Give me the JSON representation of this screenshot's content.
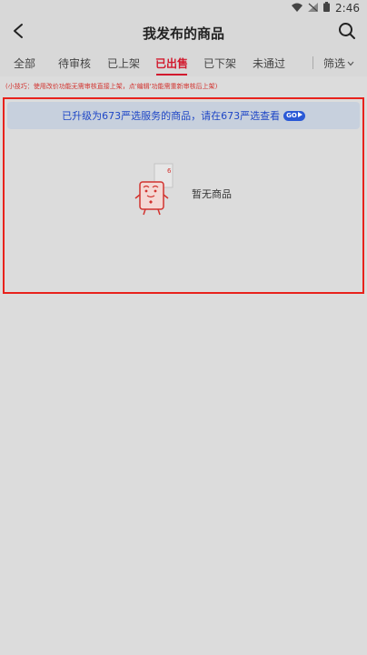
{
  "status_bar": {
    "time": "2:46"
  },
  "header": {
    "title": "我发布的商品"
  },
  "tabs": [
    {
      "label": "全部"
    },
    {
      "label": "待审核"
    },
    {
      "label": "已上架"
    },
    {
      "label": "已出售"
    },
    {
      "label": "已下架"
    },
    {
      "label": "未通过"
    }
  ],
  "active_tab": "已出售",
  "filter": {
    "label": "筛选"
  },
  "tip": "(小技巧：使用改价功能无需审核直接上架，点'编辑'功能需重新审核后上架)",
  "banner": {
    "text": "已升级为673严选服务的商品，请在673严选查看",
    "go_label": "GO"
  },
  "empty_state": {
    "text": "暂无商品"
  },
  "colors": {
    "accent": "#d21a2e",
    "banner_text": "#1f47c6",
    "banner_bg": "#c7d0dd",
    "highlight_border": "#e8221c"
  }
}
